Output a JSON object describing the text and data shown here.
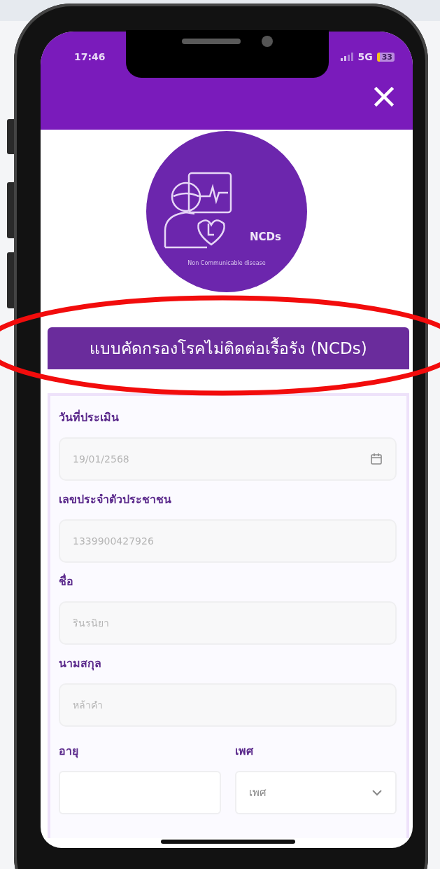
{
  "status_bar": {
    "time": "17:46",
    "network": "5G",
    "battery": "33"
  },
  "logo": {
    "title": "NCDs",
    "subtitle": "Non Communicable disease"
  },
  "form": {
    "title": "แบบคัดกรองโรคไม่ติดต่อเรื้อรัง (NCDs)",
    "fields": [
      {
        "kind": "date",
        "label": "วันที่ประเมิน",
        "value": "19/01/2568"
      },
      {
        "kind": "text",
        "label": "เลขประจำตัวประชาชน",
        "value": "1339900427926"
      },
      {
        "kind": "text",
        "label": "ชื่อ",
        "value": "รินรนิยา"
      },
      {
        "kind": "text",
        "label": "นามสกุล",
        "value": "หล้าคำ"
      }
    ],
    "row": [
      {
        "kind": "input",
        "label": "อายุ"
      },
      {
        "kind": "select",
        "label": "เพศ",
        "placeholder": "เพศ"
      }
    ]
  }
}
